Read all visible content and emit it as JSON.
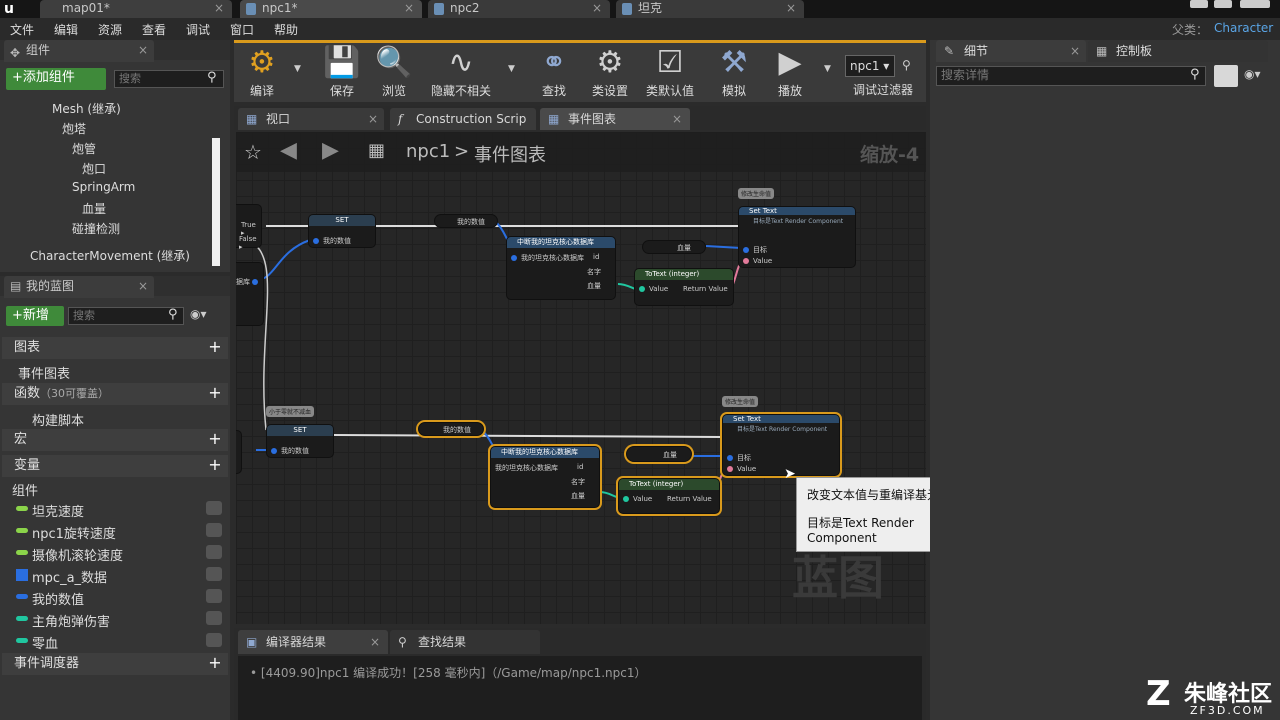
{
  "window": {
    "tabs": [
      {
        "label": "map01*"
      },
      {
        "label": "npc1*"
      },
      {
        "label": "npc2"
      },
      {
        "label": "坦克"
      }
    ],
    "parent_label": "父类：",
    "parent_value": "Character"
  },
  "menu": [
    "文件",
    "编辑",
    "资源",
    "查看",
    "调试",
    "窗口",
    "帮助"
  ],
  "components_panel": {
    "title": "组件",
    "add_button": "+添加组件",
    "search_placeholder": "搜索",
    "tree": [
      "Mesh (继承)",
      "炮塔",
      "炮管",
      "炮口",
      "SpringArm",
      "血量",
      "碰撞检测",
      "CharacterMovement (继承)"
    ]
  },
  "my_blueprint": {
    "title": "我的蓝图",
    "new_button": "+新增",
    "search_placeholder": "搜索",
    "sections": {
      "graphs": "图表",
      "event_graph": "事件图表",
      "functions": "函数",
      "functions_override": "（30可覆盖）",
      "construction": "构建脚本",
      "macros": "宏",
      "variables": "变量",
      "components": "组件",
      "dispatchers": "事件调度器"
    },
    "variables": [
      {
        "name": "坦克速度",
        "color": "#8bd44a"
      },
      {
        "name": "npc1旋转速度",
        "color": "#8bd44a"
      },
      {
        "name": "摄像机滚轮速度",
        "color": "#8bd44a"
      },
      {
        "name": "mpc_a_数据",
        "color": "#2a6ee0"
      },
      {
        "name": "我的数值",
        "color": "#2a6ee0"
      },
      {
        "name": "主角炮弹伤害",
        "color": "#20c7a0"
      },
      {
        "name": "零血",
        "color": "#20c7a0"
      }
    ]
  },
  "toolbar": [
    {
      "label": "编译",
      "icon": "compile-icon"
    },
    {
      "label": "保存",
      "icon": "save-icon"
    },
    {
      "label": "浏览",
      "icon": "browse-icon"
    },
    {
      "label": "隐藏不相关",
      "icon": "hide-unrelated-icon"
    },
    {
      "label": "查找",
      "icon": "find-icon"
    },
    {
      "label": "类设置",
      "icon": "class-settings-icon"
    },
    {
      "label": "类默认值",
      "icon": "class-defaults-icon"
    },
    {
      "label": "模拟",
      "icon": "simulate-icon"
    },
    {
      "label": "播放",
      "icon": "play-icon"
    }
  ],
  "debug_filter": {
    "value": "npc1",
    "label": "调试过滤器"
  },
  "editor_tabs": [
    {
      "label": "视口"
    },
    {
      "label": "Construction Scrip"
    },
    {
      "label": "事件图表"
    }
  ],
  "breadcrumb": {
    "root": "npc1",
    "sep": ">",
    "current": "事件图表",
    "zoom": "缩放-4"
  },
  "graph_watermark": "蓝图",
  "nodes": {
    "true_label": "True",
    "false_label": "False",
    "set": "SET",
    "my_value": "我的数值",
    "break_struct": "中断我的坦克核心数据库",
    "break_struct_pin": "我的坦克核心数据库",
    "id": "id",
    "name": "名字",
    "hp": "血量",
    "totext": "ToText (integer)",
    "value": "Value",
    "return_value": "Return Value",
    "set_text": "Set Text",
    "set_text_sub": "目标是Text Render Component",
    "target": "目标",
    "comment1": "修改生命值",
    "comment2": "小于零就不减血",
    "comment3": "修改生命值",
    "cut_label": "数据库"
  },
  "tooltip": {
    "line1": "改变文本值与重编译基元的信号",
    "line2": "目标是Text Render Component"
  },
  "bottom_tabs": [
    {
      "label": "编译器结果"
    },
    {
      "label": "查找结果"
    }
  ],
  "log": "[4409.90]npc1 编译成功！[258 毫秒内]（/Game/map/npc1.npc1）",
  "details": {
    "title": "细节",
    "search_placeholder": "搜索详情"
  },
  "console": {
    "title": "控制板"
  },
  "watermark": {
    "brand": "朱峰社区",
    "url": "ZF3D.COM"
  }
}
